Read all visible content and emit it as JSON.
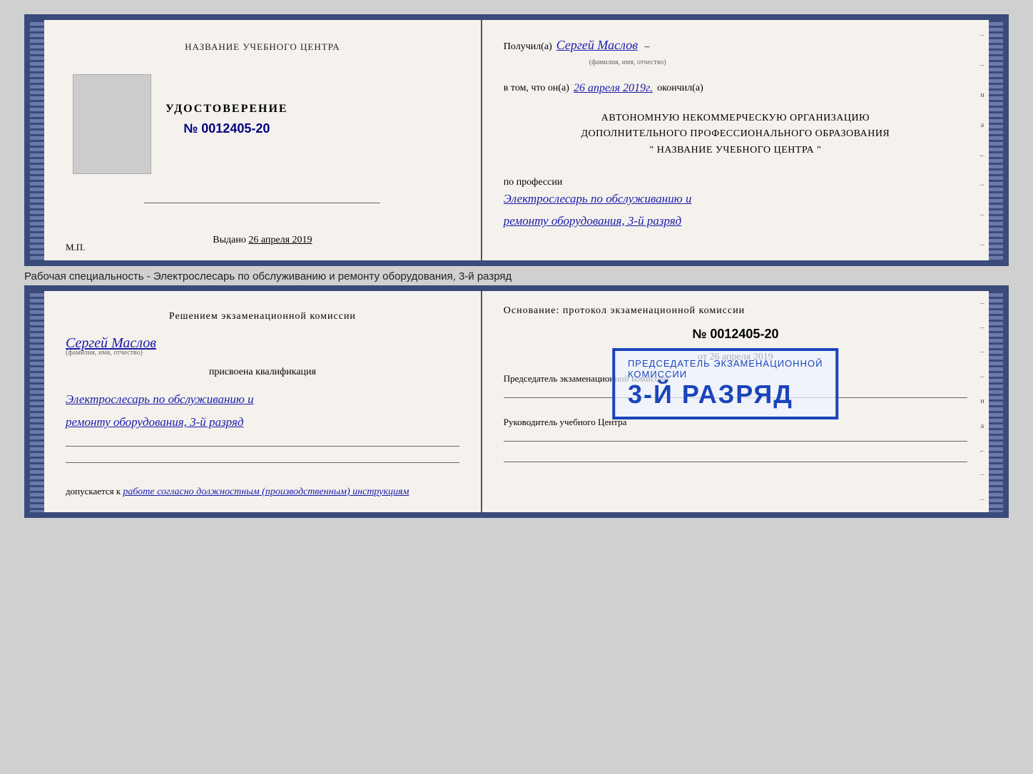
{
  "doc1": {
    "left": {
      "center_title": "НАЗВАНИЕ УЧЕБНОГО ЦЕНТРА",
      "udost_label": "УДОСТОВЕРЕНИЕ",
      "udost_number": "№ 0012405-20",
      "vydano_label": "Выдано",
      "vydano_date": "26 апреля 2019",
      "mp_label": "М.П."
    },
    "right": {
      "poluchil_prefix": "Получил(а)",
      "recipient_name": "Сергей Маслов",
      "fio_label": "(фамилия, имя, отчество)",
      "vtom_prefix": "в том, что он(а)",
      "completion_date": "26 апреля 2019г.",
      "okончил_suffix": "окончил(а)",
      "org_line1": "АВТОНОМНУЮ НЕКОММЕРЧЕСКУЮ ОРГАНИЗАЦИЮ",
      "org_line2": "ДОПОЛНИТЕЛЬНОГО ПРОФЕССИОНАЛЬНОГО ОБРАЗОВАНИЯ",
      "org_line3": "\"   НАЗВАНИЕ УЧЕБНОГО ЦЕНТРА   \"",
      "po_professii": "по профессии",
      "profession_line1": "Электрослесарь по обслуживанию и",
      "profession_line2": "ремонту оборудования, 3-й разряд"
    }
  },
  "between_label": "Рабочая специальность - Электрослесарь по обслуживанию и ремонту оборудования, 3-й разряд",
  "doc2": {
    "left": {
      "resheniem_title": "Решением  экзаменационной  комиссии",
      "recipient_name": "Сергей Маслов",
      "fio_label": "(фамилия, имя, отчество)",
      "prisvoena": "присвоена квалификация",
      "profession_line1": "Электрослесарь по обслуживанию и",
      "profession_line2": "ремонту оборудования, 3-й разряд",
      "dopuskaetsya_prefix": "допускается к",
      "dopusk_text": "работе согласно должностным (производственным) инструкциям"
    },
    "right": {
      "osnovanie_title": "Основание: протокол экзаменационной  комиссии",
      "protocol_number": "№  0012405-20",
      "ot_prefix": "от",
      "ot_date": "26 апреля 2019",
      "predsedatel_title": "Председатель экзаменационной комиссии",
      "rukovoditel_title": "Руководитель учебного Центра"
    },
    "stamp": {
      "line1": "3-й разряд"
    }
  }
}
